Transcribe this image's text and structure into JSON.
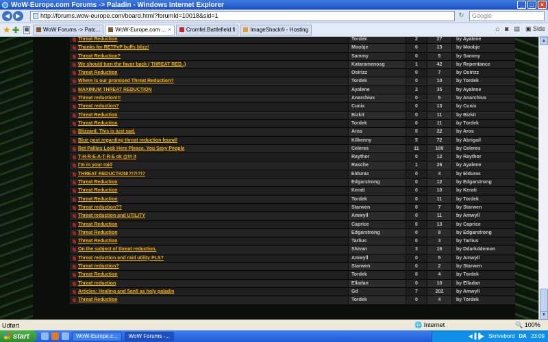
{
  "window": {
    "title": "WoW-Europe.com Forums -> Paladin - Windows Internet Explorer"
  },
  "navbar": {
    "url": "http://forums.wow-europe.com/board.html?forumId=10018&sid=1",
    "search_placeholder": "Google"
  },
  "tabs": [
    {
      "label": "WoW Forums -> Patc..."
    },
    {
      "label": "WoW-Europe.com ..."
    },
    {
      "label": "Cromfel.Battlefield.fi"
    },
    {
      "label": "ImageShack® - Hosting"
    }
  ],
  "toolbar": {
    "page_label": "Side"
  },
  "threads": [
    {
      "title": "Threat Reduction",
      "author": "Tordek",
      "replies": "2",
      "views": "27",
      "last": "by Ayalene"
    },
    {
      "title": "Thanks for RETPvP buffs blizz!",
      "author": "Moobje",
      "replies": "0",
      "views": "13",
      "last": "by Moobje"
    },
    {
      "title": "Threat Reduction?",
      "author": "Sammy",
      "replies": "0",
      "views": "5",
      "last": "by Sammy"
    },
    {
      "title": "We should turn the favor back ( THREAT RED..)",
      "author": "Kataramenosg",
      "replies": "1",
      "views": "42",
      "last": "by Repentance"
    },
    {
      "title": "Threat Reduction",
      "author": "Osirizz",
      "replies": "0",
      "views": "7",
      "last": "by Osirizz"
    },
    {
      "title": "Where is our promised Threat Reduction?",
      "author": "Tordek",
      "replies": "0",
      "views": "10",
      "last": "by Tordek"
    },
    {
      "title": "MAXIMUM THREAT REDUCTION",
      "author": "Ayalene",
      "replies": "2",
      "views": "35",
      "last": "by Ayalene"
    },
    {
      "title": "Threat reduction!!!",
      "author": "Anarchius",
      "replies": "0",
      "views": "5",
      "last": "by Anarchius"
    },
    {
      "title": "Threat reduction?",
      "author": "Cunix",
      "replies": "0",
      "views": "13",
      "last": "by Cunix"
    },
    {
      "title": "Threat Reduction",
      "author": "Bizkit",
      "replies": "0",
      "views": "11",
      "last": "by Bizkit"
    },
    {
      "title": "Threat Reduction",
      "author": "Tordek",
      "replies": "0",
      "views": "11",
      "last": "by Tordek"
    },
    {
      "title": "Blizzard. This is just sad.",
      "author": "Aros",
      "replies": "0",
      "views": "22",
      "last": "by Aros"
    },
    {
      "title": "Blue post regarding threat reduction found!",
      "author": "Kilkenny",
      "replies": "5",
      "views": "72",
      "last": "by Abrigail"
    },
    {
      "title": "Ret Pallies Look Here Please. You Sexy People",
      "author": "Celeres",
      "replies": "11",
      "views": "109",
      "last": "by Celeres"
    },
    {
      "title": "T-H-R-E-A-T-R-E ok @!# it",
      "author": "Raythor",
      "replies": "0",
      "views": "12",
      "last": "by Raythor"
    },
    {
      "title": "I'm in your raid",
      "author": "Rasche",
      "replies": "1",
      "views": "26",
      "last": "by Ayalene"
    },
    {
      "title": "THREAT REDUCTION!?!?!?!?",
      "author": "Elduras",
      "replies": "0",
      "views": "4",
      "last": "by Elduras"
    },
    {
      "title": "Threat Reduction",
      "author": "Edgarstrong",
      "replies": "0",
      "views": "12",
      "last": "by Edgarstrong"
    },
    {
      "title": "Threat Reduction",
      "author": "Kerati",
      "replies": "0",
      "views": "10",
      "last": "by Kerati"
    },
    {
      "title": "Threat Reduction",
      "author": "Tordek",
      "replies": "0",
      "views": "11",
      "last": "by Tordek"
    },
    {
      "title": "Threat reduction??",
      "author": "Starwen",
      "replies": "0",
      "views": "7",
      "last": "by Starwen"
    },
    {
      "title": "Threat reduction and UTILITY",
      "author": "Amwyll",
      "replies": "0",
      "views": "11",
      "last": "by Amwyll"
    },
    {
      "title": "Threat Reduction",
      "author": "Caprice",
      "replies": "0",
      "views": "13",
      "last": "by Caprice"
    },
    {
      "title": "Threat Reduction",
      "author": "Edgarstrong",
      "replies": "0",
      "views": "9",
      "last": "by Edgarstrong"
    },
    {
      "title": "Threat Reduction",
      "author": "Tarlius",
      "replies": "0",
      "views": "3",
      "last": "by Tarlius"
    },
    {
      "title": "On the subject of threat reduction.",
      "author": "Shivan",
      "replies": "3",
      "views": "16",
      "last": "by Ddarkddemon"
    },
    {
      "title": "Threat reduction and raid utility PLS?",
      "author": "Amwyll",
      "replies": "0",
      "views": "5",
      "last": "by Amwyll"
    },
    {
      "title": "Threat reduction?",
      "author": "Starwen",
      "replies": "0",
      "views": "2",
      "last": "by Starwen"
    },
    {
      "title": "Threat Reduction",
      "author": "Tordek",
      "replies": "0",
      "views": "4",
      "last": "by Tordek"
    },
    {
      "title": "Threat reduction",
      "author": "Elladan",
      "replies": "0",
      "views": "10",
      "last": "by Elladan"
    },
    {
      "title": "Articles: Healing and 5on5 as holy paladin",
      "author": "Gd",
      "replies": "7",
      "views": "202",
      "last": "by Amwyll"
    },
    {
      "title": "Threat Reduction",
      "author": "Tordek",
      "replies": "0",
      "views": "4",
      "last": "by Tordek"
    }
  ],
  "statusbar": {
    "status": "Udført",
    "zone": "Internet",
    "zoom": "100%"
  },
  "taskbar": {
    "start": "start",
    "tasks": [
      {
        "label": "WoW-Europe.c..."
      },
      {
        "label": "WoW Forums -..."
      }
    ],
    "language": "DA",
    "clock": "23:09",
    "desktop_label": "Skrivebord"
  }
}
